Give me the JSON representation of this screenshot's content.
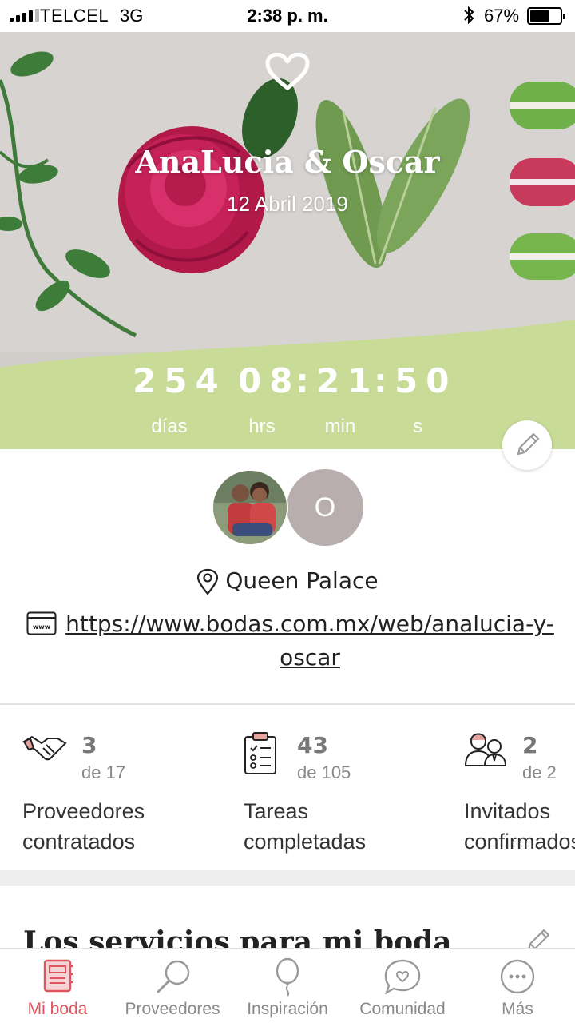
{
  "status_bar": {
    "carrier": "TELCEL",
    "network": "3G",
    "time": "2:38 p. m.",
    "battery_percent": "67%",
    "battery_level": 0.67
  },
  "hero": {
    "couple_names": "AnaLucia & Oscar",
    "wedding_date": "12 Abril 2019",
    "countdown": {
      "days": "254",
      "hours": "08",
      "minutes": "21",
      "seconds": "50",
      "days_label": "días",
      "hours_label": "hrs",
      "minutes_label": "min",
      "seconds_label": "s"
    }
  },
  "couple": {
    "partner_initial": "O",
    "location": "Queen Palace",
    "website": "https://www.bodas.com.mx/web/analucia-y-oscar"
  },
  "stats": [
    {
      "value": "3",
      "total": "de 17",
      "label": "Proveedores\ncontratados",
      "icon": "handshake-icon"
    },
    {
      "value": "43",
      "total": "de 105",
      "label": "Tareas\ncompletadas",
      "icon": "clipboard-checklist-icon"
    },
    {
      "value": "2",
      "total": "de 2",
      "label": "Invitados\nconfirmados",
      "icon": "guests-icon"
    }
  ],
  "services_section": {
    "title": "Los servicios para mi boda"
  },
  "tabbar": {
    "items": [
      {
        "label": "Mi boda",
        "icon": "notebook-icon",
        "active": true
      },
      {
        "label": "Proveedores",
        "icon": "search-icon",
        "active": false
      },
      {
        "label": "Inspiración",
        "icon": "balloon-icon",
        "active": false
      },
      {
        "label": "Comunidad",
        "icon": "chat-heart-icon",
        "active": false
      },
      {
        "label": "Más",
        "icon": "more-icon",
        "active": false
      }
    ]
  },
  "colors": {
    "accent": "#e0545e",
    "countdown_band": "#c8dc98",
    "avatar_initial_bg": "#b9aeae"
  }
}
